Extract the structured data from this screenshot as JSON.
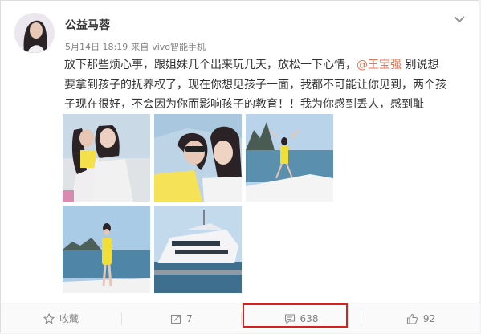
{
  "post": {
    "username": "公益马蓉",
    "date": "5月14日 18:19",
    "source_prefix": "来自",
    "source_device": "vivo智能手机",
    "text_before_mention": "放下那些烦心事，跟姐妹几个出来玩几天，放松一下心情，",
    "mention": "@王宝强",
    "text_after_mention": " 别说想要拿到孩子的抚养权了，现在你想见孩子一面，我都不可能让你见到，两个孩子现在很好，不会因为你而影响孩子的教育！！我为你感到丢人，感到耻辱！！"
  },
  "actions": {
    "favorite_label": "收藏",
    "repost_count": "7",
    "comment_count": "638",
    "like_count": "92"
  },
  "colors": {
    "mention": "#eb7350",
    "highlight_border": "#d62121",
    "meta_text": "#808080"
  },
  "icons": [
    "avatar",
    "chevron-down-icon",
    "favorite-star-icon",
    "repost-icon",
    "comment-icon",
    "like-icon"
  ]
}
